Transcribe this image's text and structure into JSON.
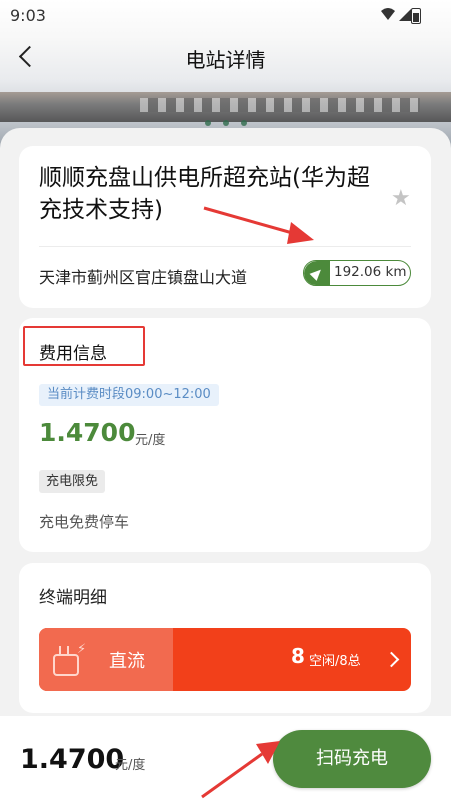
{
  "status_bar": {
    "time": "9:03"
  },
  "nav": {
    "title": "电站详情"
  },
  "station": {
    "name": "顺顺充盘山供电所超充站(华为超充技术支持)",
    "address": "天津市蓟州区官庄镇盘山大道",
    "distance": "192.06 km"
  },
  "fee": {
    "title": "费用信息",
    "period": "当前计费时段09:00~12:00",
    "price": "1.4700",
    "unit": "元/度",
    "tag": "充电限免",
    "parking": "充电免费停车"
  },
  "terminal": {
    "title": "终端明细",
    "type": "直流",
    "free": "8",
    "free_total": "空闲/8总"
  },
  "bottom": {
    "price": "1.4700",
    "unit": "元/度",
    "scan_button": "扫码充电"
  },
  "colors": {
    "brand_green": "#4f8a3e",
    "dc_red": "#f2401a",
    "annotation_red": "#e53935"
  },
  "icons": [
    "back-arrow-icon",
    "star-icon",
    "navigation-icon",
    "plug-icon",
    "chevron-right-icon",
    "wifi-icon",
    "signal-icon",
    "battery-icon"
  ]
}
